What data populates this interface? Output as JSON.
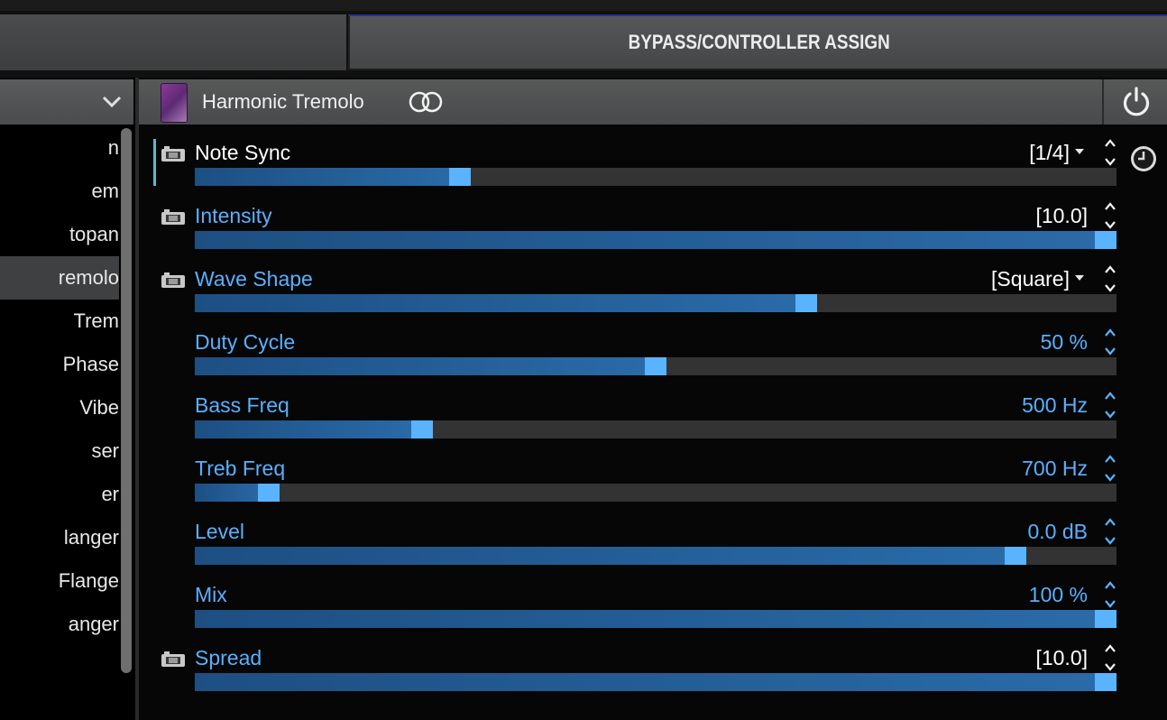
{
  "tabs": {
    "bypass_label": "BYPASS/CONTROLLER ASSIGN"
  },
  "left_list": {
    "items": [
      {
        "label": "n",
        "active": false
      },
      {
        "label": "em",
        "active": false
      },
      {
        "label": "topan",
        "active": false
      },
      {
        "label": "remolo",
        "active": true
      },
      {
        "label": "Trem",
        "active": false
      },
      {
        "label": "Phase",
        "active": false
      },
      {
        "label": "Vibe",
        "active": false
      },
      {
        "label": "ser",
        "active": false
      },
      {
        "label": "er",
        "active": false
      },
      {
        "label": "langer",
        "active": false
      },
      {
        "label": "Flange",
        "active": false
      },
      {
        "label": "anger",
        "active": false
      }
    ]
  },
  "effect": {
    "name": "Harmonic Tremolo"
  },
  "params": [
    {
      "name": "Note Sync",
      "value": "[1/4]",
      "level": 0.283,
      "camera": true,
      "dropdown": true,
      "selected": true
    },
    {
      "name": "Intensity",
      "value": "[10.0]",
      "level": 1.0,
      "camera": true,
      "dropdown": false,
      "selected": false
    },
    {
      "name": "Wave Shape",
      "value": "[Square]",
      "level": 0.667,
      "camera": true,
      "dropdown": true,
      "selected": false
    },
    {
      "name": "Duty Cycle",
      "value": "50 %",
      "level": 0.5,
      "camera": false,
      "dropdown": false,
      "selected": false
    },
    {
      "name": "Bass Freq",
      "value": "500 Hz",
      "level": 0.24,
      "camera": false,
      "dropdown": false,
      "selected": false
    },
    {
      "name": "Treb Freq",
      "value": "700 Hz",
      "level": 0.07,
      "camera": false,
      "dropdown": false,
      "selected": false
    },
    {
      "name": "Level",
      "value": "0.0 dB",
      "level": 0.9,
      "camera": false,
      "dropdown": false,
      "selected": false
    },
    {
      "name": "Mix",
      "value": "100 %",
      "level": 1.0,
      "camera": false,
      "dropdown": false,
      "selected": false
    },
    {
      "name": "Spread",
      "value": "[10.0]",
      "level": 1.0,
      "camera": true,
      "dropdown": false,
      "selected": false
    }
  ],
  "colors": {
    "accent": "#59b3ff",
    "fill": "#2a6ba8",
    "track": "#333333",
    "bypass_tab_border": "#27348c"
  },
  "icons": {
    "chevron": "chevron-down-icon",
    "link": "link-rings-icon",
    "power": "power-icon",
    "clock": "clock-icon",
    "camera": "camera-icon",
    "stepper": "stepper-arrows-icon"
  }
}
